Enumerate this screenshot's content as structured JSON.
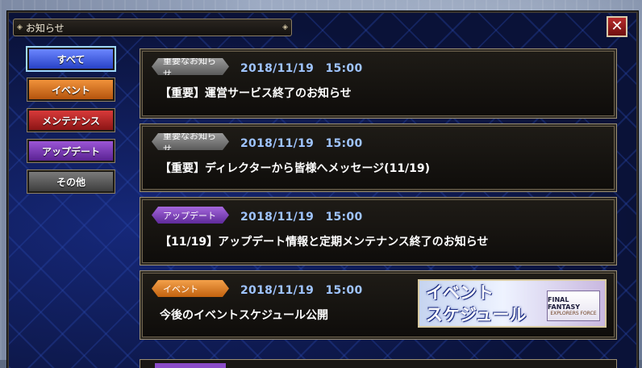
{
  "window": {
    "title": "お知らせ",
    "close_label": "✕"
  },
  "categories": [
    {
      "label": "すべて",
      "key": "all"
    },
    {
      "label": "イベント",
      "key": "event"
    },
    {
      "label": "メンテナンス",
      "key": "maint"
    },
    {
      "label": "アップデート",
      "key": "update"
    },
    {
      "label": "その他",
      "key": "other"
    }
  ],
  "news": [
    {
      "tag": "重要なお知らせ",
      "date": "2018/11/19　15:00",
      "title": "【重要】運営サービス終了のお知らせ"
    },
    {
      "tag": "重要なお知らせ",
      "date": "2018/11/19　15:00",
      "title": "【重要】ディレクターから皆様へメッセージ(11/19)"
    },
    {
      "tag": "アップデート",
      "date": "2018/11/19　15:00",
      "title": "【11/19】アップデート情報と定期メンテナンス終了のお知らせ"
    },
    {
      "tag": "イベント",
      "date": "2018/11/19　15:00",
      "title": "今後のイベントスケジュール公開",
      "banner_text": "イベント\nスケジュール",
      "banner_logo": "FINAL FANTASY",
      "banner_logo_sub": "EXPLORERS FORCE"
    }
  ],
  "colors": {
    "selected_tab": "#2842c6",
    "date_text": "#9fc4ff",
    "important_tag": "#7a7a7a",
    "update_tag": "#8a4bc8",
    "event_tag": "#e07a22"
  }
}
